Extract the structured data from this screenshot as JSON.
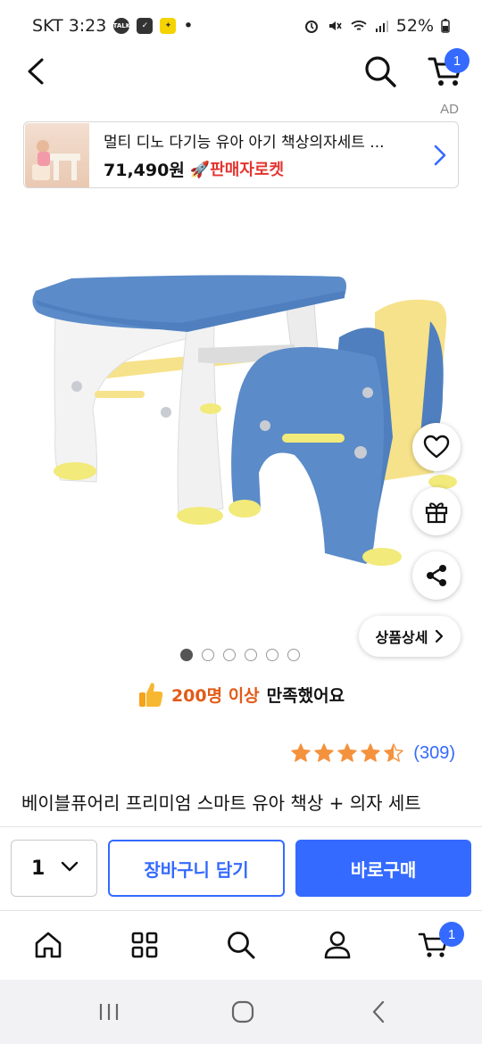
{
  "status_bar": {
    "carrier_time": "SKT 3:23",
    "talk_icon_label": "TALK",
    "dot": "•",
    "battery": "52%"
  },
  "header": {
    "cart_count": "1"
  },
  "ad": {
    "label": "AD",
    "title": "멀티 디노 다기능 유아 아기 책상의자세트 ...",
    "price": "71,490원",
    "badge": "판매자로켓"
  },
  "gallery": {
    "detail_button": "상품상세",
    "slides": [
      "1",
      "2",
      "3",
      "4",
      "5",
      "6"
    ],
    "active_index": 0
  },
  "satisfaction": {
    "highlight": "200명 이상",
    "rest": "만족했어요"
  },
  "rating": {
    "stars": 4.5,
    "count": "(309)"
  },
  "product": {
    "title": "베이블퓨어리 프리미엄 스마트 유아 책상 + 의자 세트"
  },
  "actions": {
    "quantity": "1",
    "add_to_cart": "장바구니 담기",
    "buy_now": "바로구매"
  },
  "bottom_nav": {
    "cart_count": "1"
  },
  "colors": {
    "accent": "#346aff",
    "highlight": "#e25c18",
    "star": "#f5923e"
  }
}
